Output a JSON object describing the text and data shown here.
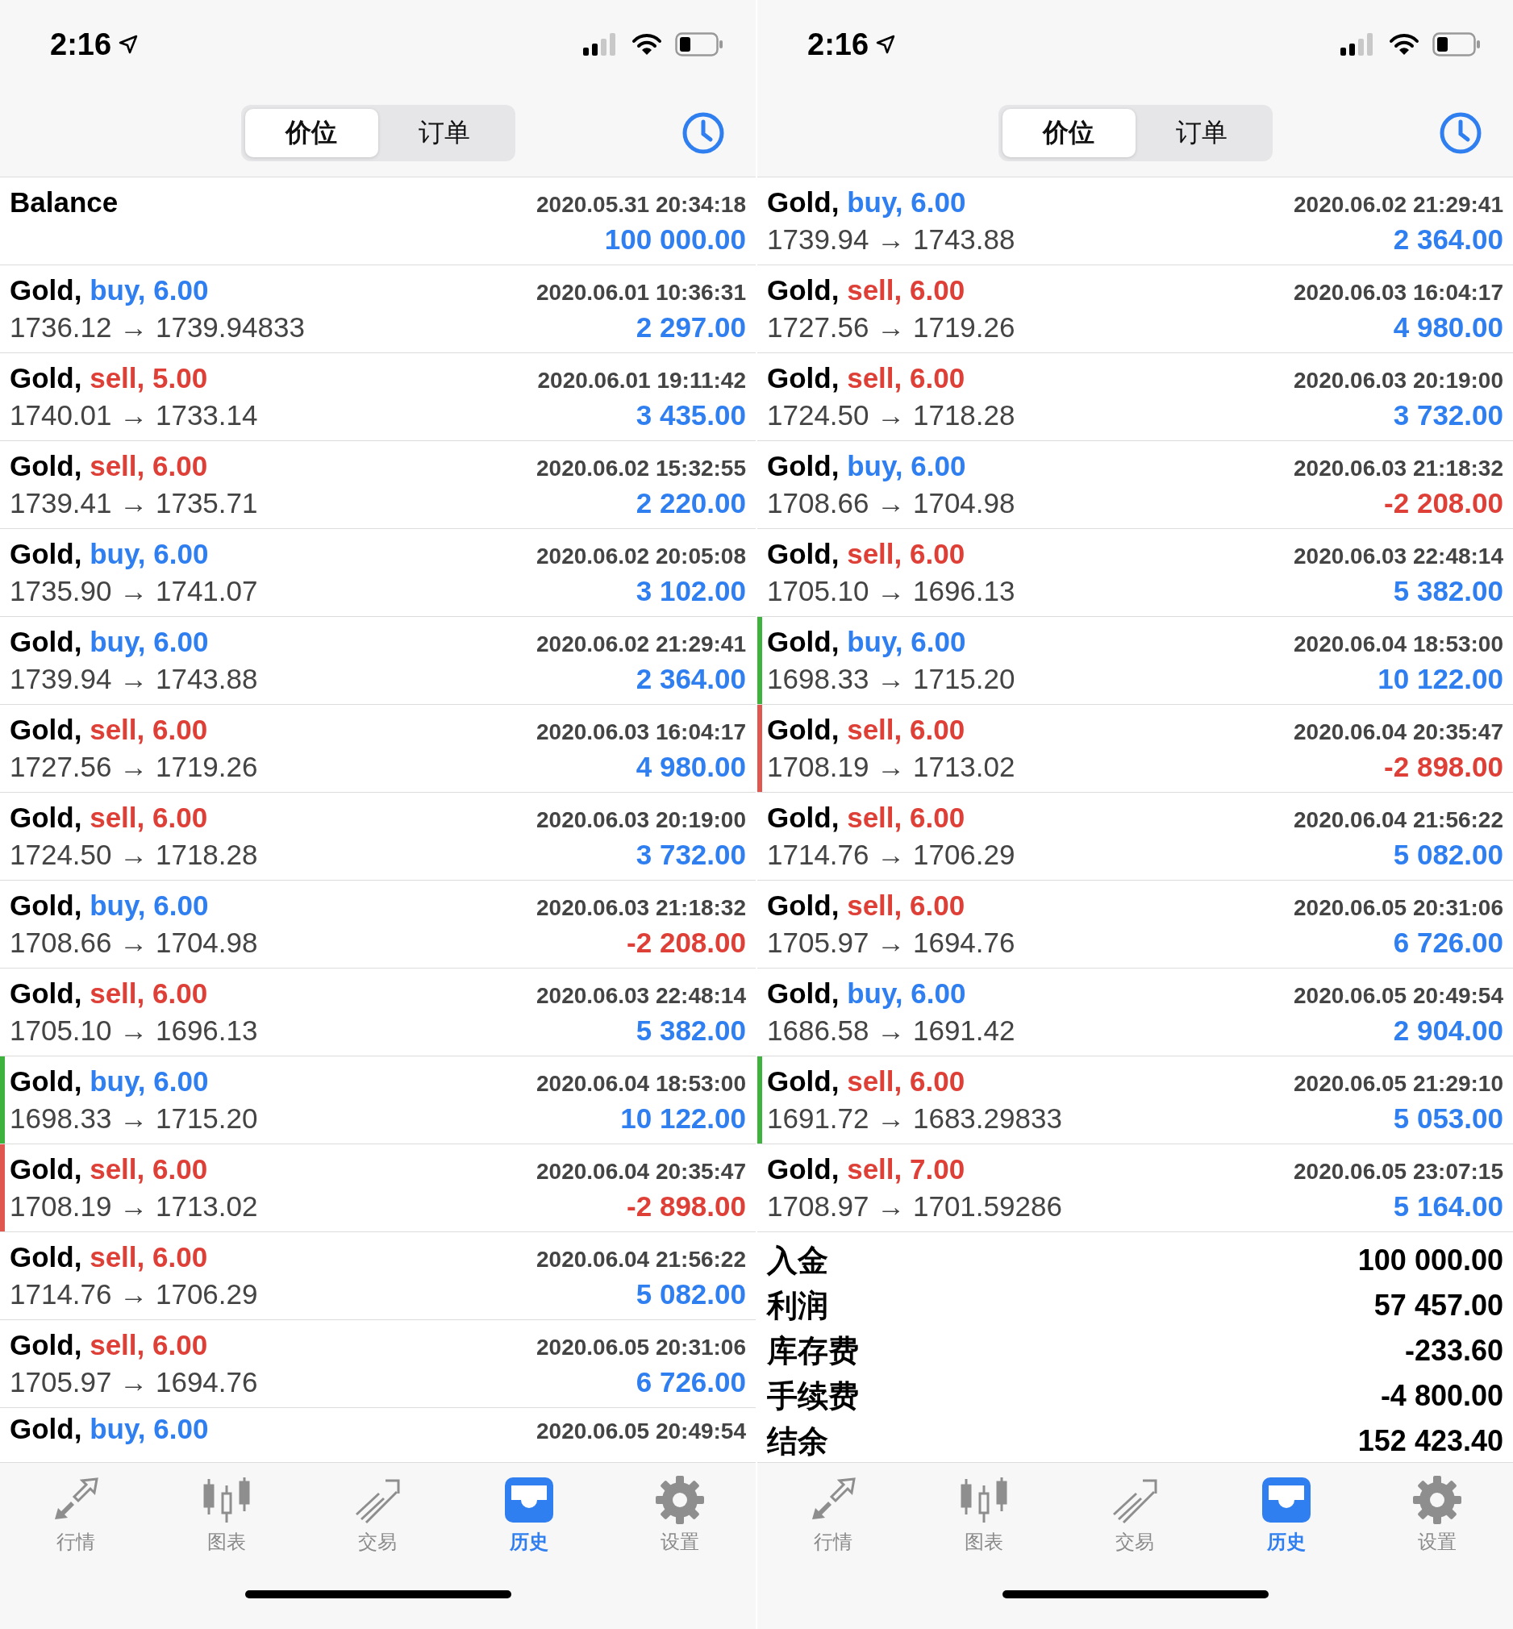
{
  "screens": [
    {
      "status_bar": {
        "time": "2:16"
      },
      "segments": [
        {
          "label": "价位",
          "selected": true
        },
        {
          "label": "订单",
          "selected": false
        }
      ],
      "rows": [
        {
          "kind": "balance",
          "title": "Balance",
          "time": "2020.05.31 20:34:18",
          "profit": "100 000.00",
          "loss": false
        },
        {
          "kind": "buy",
          "title": "Gold,",
          "side": "buy, 6.00",
          "time": "2020.06.01 10:36:31",
          "prices": "1736.12 → 1739.94833",
          "profit": "2 297.00",
          "loss": false
        },
        {
          "kind": "sell",
          "title": "Gold,",
          "side": "sell, 5.00",
          "time": "2020.06.01 19:11:42",
          "prices": "1740.01 → 1733.14",
          "profit": "3 435.00",
          "loss": false
        },
        {
          "kind": "sell",
          "title": "Gold,",
          "side": "sell, 6.00",
          "time": "2020.06.02 15:32:55",
          "prices": "1739.41 → 1735.71",
          "profit": "2 220.00",
          "loss": false
        },
        {
          "kind": "buy",
          "title": "Gold,",
          "side": "buy, 6.00",
          "time": "2020.06.02 20:05:08",
          "prices": "1735.90 → 1741.07",
          "profit": "3 102.00",
          "loss": false
        },
        {
          "kind": "buy",
          "title": "Gold,",
          "side": "buy, 6.00",
          "time": "2020.06.02 21:29:41",
          "prices": "1739.94 → 1743.88",
          "profit": "2 364.00",
          "loss": false
        },
        {
          "kind": "sell",
          "title": "Gold,",
          "side": "sell, 6.00",
          "time": "2020.06.03 16:04:17",
          "prices": "1727.56 → 1719.26",
          "profit": "4 980.00",
          "loss": false
        },
        {
          "kind": "sell",
          "title": "Gold,",
          "side": "sell, 6.00",
          "time": "2020.06.03 20:19:00",
          "prices": "1724.50 → 1718.28",
          "profit": "3 732.00",
          "loss": false
        },
        {
          "kind": "buy",
          "title": "Gold,",
          "side": "buy, 6.00",
          "time": "2020.06.03 21:18:32",
          "prices": "1708.66 → 1704.98",
          "profit": "-2 208.00",
          "loss": true
        },
        {
          "kind": "sell",
          "title": "Gold,",
          "side": "sell, 6.00",
          "time": "2020.06.03 22:48:14",
          "prices": "1705.10 → 1696.13",
          "profit": "5 382.00",
          "loss": false
        },
        {
          "kind": "buy",
          "title": "Gold,",
          "side": "buy, 6.00",
          "time": "2020.06.04 18:53:00",
          "prices": "1698.33 → 1715.20",
          "profit": "10 122.00",
          "loss": false,
          "color": "#3db33d"
        },
        {
          "kind": "sell",
          "title": "Gold,",
          "side": "sell, 6.00",
          "time": "2020.06.04 20:35:47",
          "prices": "1708.19 → 1713.02",
          "profit": "-2 898.00",
          "loss": true,
          "color": "#e0574f"
        },
        {
          "kind": "sell",
          "title": "Gold,",
          "side": "sell, 6.00",
          "time": "2020.06.04 21:56:22",
          "prices": "1714.76 → 1706.29",
          "profit": "5 082.00",
          "loss": false
        },
        {
          "kind": "sell",
          "title": "Gold,",
          "side": "sell, 6.00",
          "time": "2020.06.05 20:31:06",
          "prices": "1705.97 → 1694.76",
          "profit": "6 726.00",
          "loss": false
        },
        {
          "kind": "buy",
          "title": "Gold,",
          "side": "buy, 6.00",
          "time": "2020.06.05 20:49:54"
        }
      ],
      "tab_bar": [
        {
          "label": "行情",
          "selected": false
        },
        {
          "label": "图表",
          "selected": false
        },
        {
          "label": "交易",
          "selected": false
        },
        {
          "label": "历史",
          "selected": true
        },
        {
          "label": "设置",
          "selected": false
        }
      ]
    },
    {
      "status_bar": {
        "time": "2:16"
      },
      "segments": [
        {
          "label": "价位",
          "selected": true
        },
        {
          "label": "订单",
          "selected": false
        }
      ],
      "rows": [
        {
          "kind": "buy",
          "title": "Gold,",
          "side": "buy, 6.00",
          "time": "2020.06.02 21:29:41",
          "prices": "1739.94 → 1743.88",
          "profit": "2 364.00",
          "loss": false
        },
        {
          "kind": "sell",
          "title": "Gold,",
          "side": "sell, 6.00",
          "time": "2020.06.03 16:04:17",
          "prices": "1727.56 → 1719.26",
          "profit": "4 980.00",
          "loss": false
        },
        {
          "kind": "sell",
          "title": "Gold,",
          "side": "sell, 6.00",
          "time": "2020.06.03 20:19:00",
          "prices": "1724.50 → 1718.28",
          "profit": "3 732.00",
          "loss": false
        },
        {
          "kind": "buy",
          "title": "Gold,",
          "side": "buy, 6.00",
          "time": "2020.06.03 21:18:32",
          "prices": "1708.66 → 1704.98",
          "profit": "-2 208.00",
          "loss": true
        },
        {
          "kind": "sell",
          "title": "Gold,",
          "side": "sell, 6.00",
          "time": "2020.06.03 22:48:14",
          "prices": "1705.10 → 1696.13",
          "profit": "5 382.00",
          "loss": false
        },
        {
          "kind": "buy",
          "title": "Gold,",
          "side": "buy, 6.00",
          "time": "2020.06.04 18:53:00",
          "prices": "1698.33 → 1715.20",
          "profit": "10 122.00",
          "loss": false,
          "color": "#3db33d"
        },
        {
          "kind": "sell",
          "title": "Gold,",
          "side": "sell, 6.00",
          "time": "2020.06.04 20:35:47",
          "prices": "1708.19 → 1713.02",
          "profit": "-2 898.00",
          "loss": true,
          "color": "#e0574f"
        },
        {
          "kind": "sell",
          "title": "Gold,",
          "side": "sell, 6.00",
          "time": "2020.06.04 21:56:22",
          "prices": "1714.76 → 1706.29",
          "profit": "5 082.00",
          "loss": false
        },
        {
          "kind": "sell",
          "title": "Gold,",
          "side": "sell, 6.00",
          "time": "2020.06.05 20:31:06",
          "prices": "1705.97 → 1694.76",
          "profit": "6 726.00",
          "loss": false
        },
        {
          "kind": "buy",
          "title": "Gold,",
          "side": "buy, 6.00",
          "time": "2020.06.05 20:49:54",
          "prices": "1686.58 → 1691.42",
          "profit": "2 904.00",
          "loss": false
        },
        {
          "kind": "sell",
          "title": "Gold,",
          "side": "sell, 6.00",
          "time": "2020.06.05 21:29:10",
          "prices": "1691.72 → 1683.29833",
          "profit": "5 053.00",
          "loss": false,
          "color": "#3db33d"
        },
        {
          "kind": "sell",
          "title": "Gold,",
          "side": "sell, 7.00",
          "time": "2020.06.05 23:07:15",
          "prices": "1708.97 → 1701.59286",
          "profit": "5 164.00",
          "loss": false
        }
      ],
      "summary": [
        {
          "label": "入金",
          "value": "100 000.00"
        },
        {
          "label": "利润",
          "value": "57 457.00"
        },
        {
          "label": "库存费",
          "value": "-233.60"
        },
        {
          "label": "手续费",
          "value": "-4 800.00"
        },
        {
          "label": "结余",
          "value": "152 423.40"
        }
      ],
      "tab_bar": [
        {
          "label": "行情",
          "selected": false
        },
        {
          "label": "图表",
          "selected": false
        },
        {
          "label": "交易",
          "selected": false
        },
        {
          "label": "历史",
          "selected": true
        },
        {
          "label": "设置",
          "selected": false
        }
      ]
    }
  ]
}
